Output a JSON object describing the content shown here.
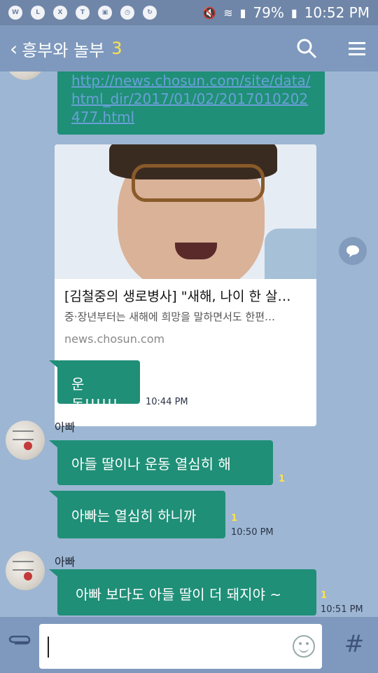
{
  "status_bar": {
    "battery": "79%",
    "time": "10:52 PM",
    "app_icons": [
      "whatsapp-icon",
      "line-icon",
      "x-icon",
      "talk-icon",
      "image-icon",
      "clock-icon",
      "sync-icon"
    ]
  },
  "header": {
    "title": "흥부와 놀부",
    "member_count": "3"
  },
  "messages": {
    "link_bubble_text": "http://news.chosun.com/site/data/html_dir/2017/01/02/2017010202477.html",
    "card": {
      "title": "[김철중의 생로병사] \"새해, 나이 한 살…",
      "description": "중·장년부터는 새해에 희망을 말하면서도 한편…",
      "domain": "news.chosun.com"
    },
    "m1": {
      "text": "운동!!!!!!",
      "time": "10:44 PM"
    },
    "sender1": "아빠",
    "m2": {
      "text": "아들  딸이나  운동  열심히  해",
      "unread": "1"
    },
    "m3": {
      "text": "아빠는 열심히  하니까",
      "unread": "1",
      "time": "10:50 PM"
    },
    "sender2": "아빠",
    "m4": {
      "text": "아빠 보다도 아들  딸이  더  돼지야 ~",
      "unread": "1",
      "time": "10:51 PM"
    }
  },
  "input": {
    "placeholder": ""
  },
  "colors": {
    "bubble": "#1f8f77",
    "header": "#7e99bd",
    "background": "#9db6d3",
    "unread": "#ffe14d"
  }
}
